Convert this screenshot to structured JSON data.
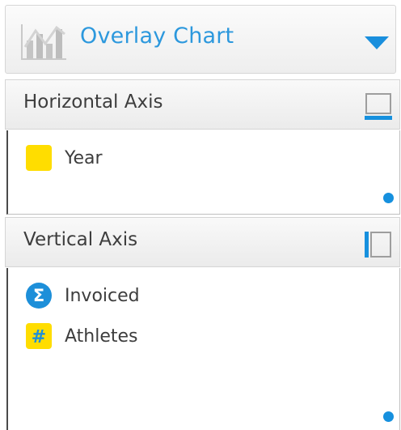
{
  "chart_selector": {
    "label": "Overlay Chart",
    "icon": "bar-line-chart-icon",
    "dropdown_icon": "caret-down-icon"
  },
  "horizontal_axis": {
    "title": "Horizontal Axis",
    "orientation_icon": "horizontal-axis-icon",
    "fields": [
      {
        "label": "Year",
        "icon": "dimension-square-icon",
        "icon_color": "#ffdd00"
      }
    ]
  },
  "vertical_axis": {
    "title": "Vertical Axis",
    "orientation_icon": "vertical-axis-icon",
    "fields": [
      {
        "label": "Invoiced",
        "icon": "sigma-icon",
        "icon_glyph": "Σ",
        "icon_color": "#1d8fd9"
      },
      {
        "label": "Athletes",
        "icon": "hash-icon",
        "icon_glyph": "#",
        "icon_color": "#ffdd00"
      }
    ]
  },
  "colors": {
    "accent": "#2c98dd",
    "handle": "#1690de",
    "dimension": "#ffdd00",
    "text": "#3d3d3d"
  }
}
